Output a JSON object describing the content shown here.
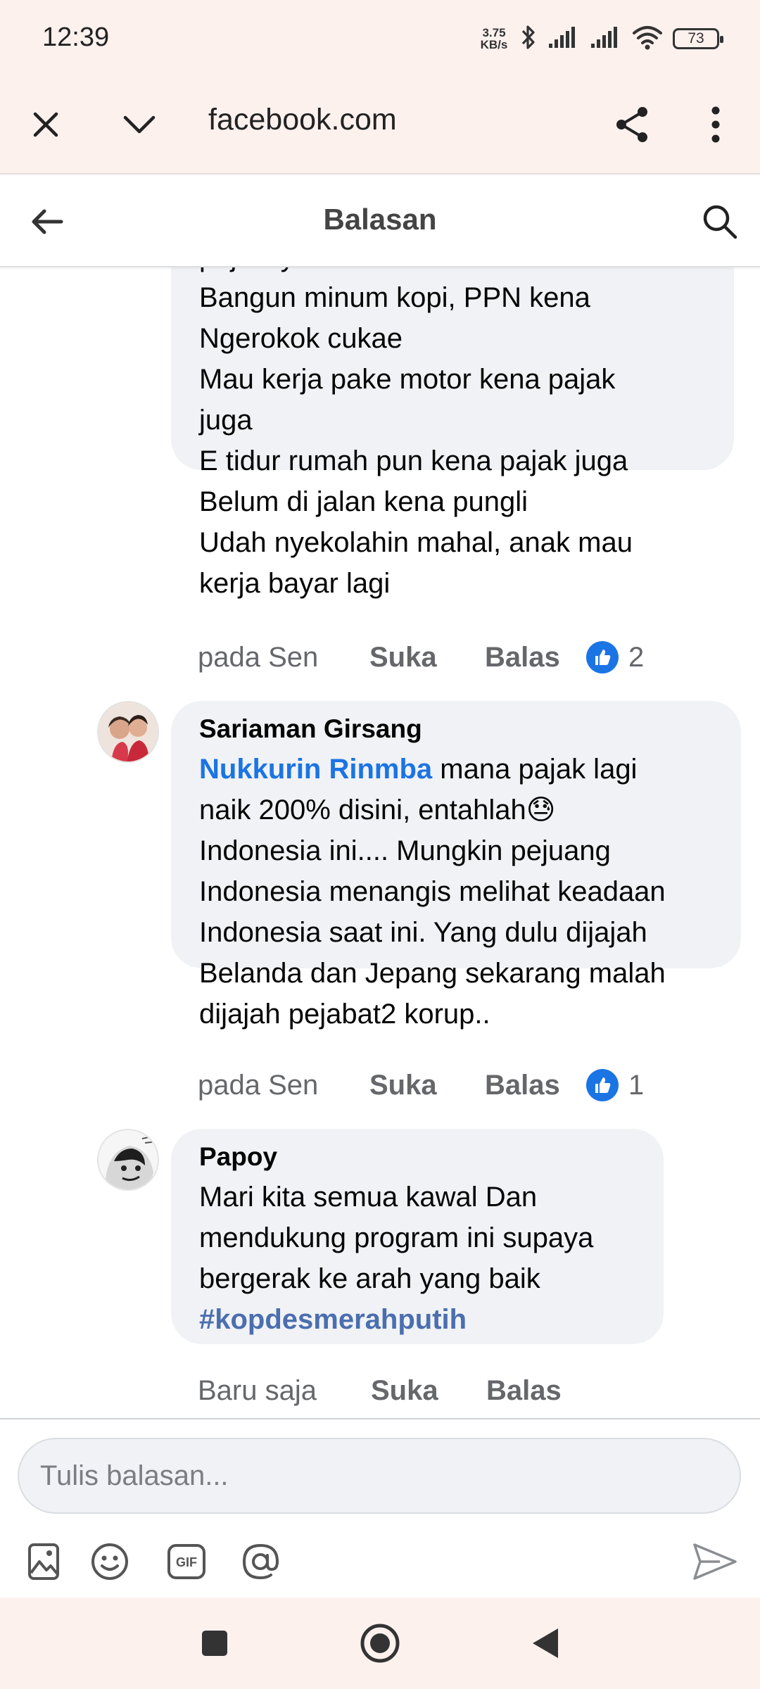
{
  "status_bar": {
    "time": "12:39",
    "net_speed_value": "3.75",
    "net_speed_unit": "KB/s",
    "battery": "73"
  },
  "browser": {
    "url": "facebook.com"
  },
  "header": {
    "title": "Balasan"
  },
  "comments": [
    {
      "author": "",
      "lines": [
        "pajak iya",
        "Bangun minum kopi, PPN kena",
        "Ngerokok cukae",
        "Mau kerja pake motor kena pajak",
        "juga",
        "E tidur rumah pun kena pajak juga",
        "Belum di jalan kena pungli",
        "Udah nyekolahin mahal, anak mau",
        "kerja bayar lagi"
      ],
      "time": "pada Sen",
      "like_label": "Suka",
      "reply_label": "Balas",
      "reaction_count": "2"
    },
    {
      "author": "Sariaman Girsang",
      "mention": "Nukkurin Rinmba",
      "first_line_rest": " mana pajak lagi",
      "second_line": "naik 200% disini, entahlah",
      "emoji": "😓",
      "lines": [
        "Indonesia ini.... Mungkin pejuang",
        "Indonesia menangis melihat keadaan",
        "Indonesia saat ini. Yang dulu dijajah",
        "Belanda dan Jepang sekarang malah",
        "dijajah pejabat2 korup.."
      ],
      "time": "pada Sen",
      "like_label": "Suka",
      "reply_label": "Balas",
      "reaction_count": "1"
    },
    {
      "author": "Papoy",
      "lines": [
        "Mari kita semua kawal Dan",
        "mendukung program ini supaya",
        "bergerak ke arah yang baik"
      ],
      "hashtag": "#kopdesmerahputih",
      "time": "Baru saja",
      "like_label": "Suka",
      "reply_label": "Balas"
    }
  ],
  "composer": {
    "placeholder": "Tulis balasan..."
  },
  "colors": {
    "system_bar_bg": "#fdf1ee",
    "bubble_bg": "#f0f2f5",
    "mention": "#1b74e4",
    "hashtag": "#4b6eaf",
    "muted_text": "#65676b"
  }
}
